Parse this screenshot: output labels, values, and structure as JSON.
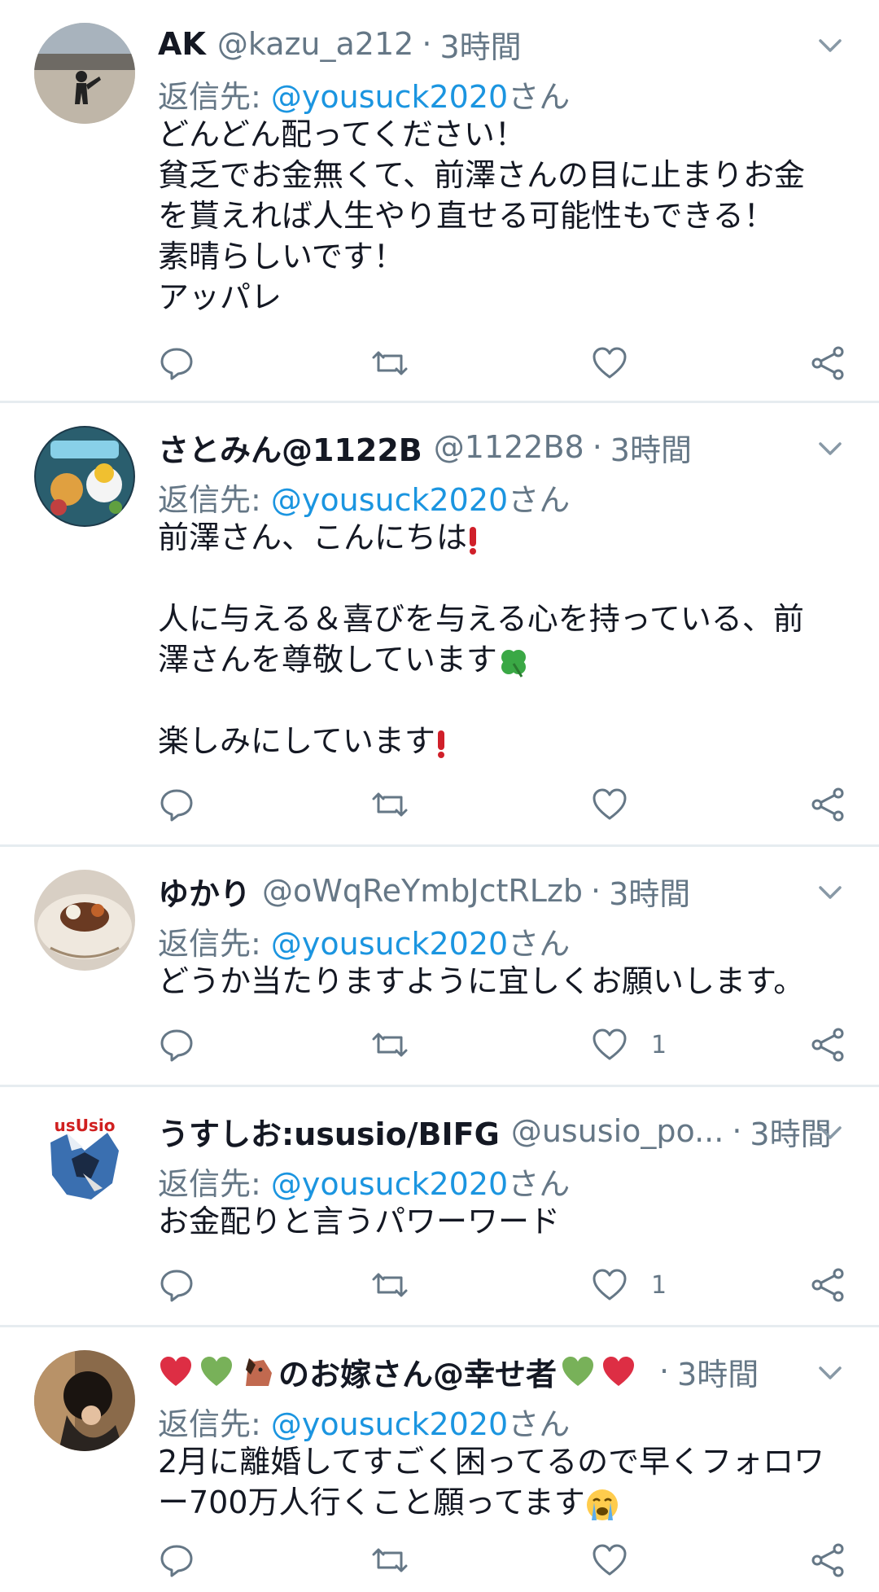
{
  "tweets": [
    {
      "name": "AK",
      "handle": "@kazu_a212",
      "separator": "·",
      "time": "3時間",
      "reply_prefix": "返信先: ",
      "reply_mention": "@yousuck2020",
      "reply_suffix": "さん",
      "body": "どんどん配ってください！\n貧乏でお金無くて、前澤さんの目に止まりお金\nを貰えれば人生やり直せる可能性もできる！\n素晴らしいです！\nアッパレ",
      "like_count": ""
    },
    {
      "name": "さとみん@1122B",
      "handle": "@1122B8",
      "separator": "·",
      "time": "3時間",
      "reply_prefix": "返信先: ",
      "reply_mention": "@yousuck2020",
      "reply_suffix": "さん",
      "body_line1": "前澤さん、こんにちは",
      "body_line2": "人に与える＆喜びを与える心を持っている、前\n澤さんを尊敬しています",
      "body_line3": "楽しみにしています",
      "like_count": ""
    },
    {
      "name": "ゆかり",
      "handle": "@oWqReYmbJctRLzb",
      "separator": "·",
      "time": "3時間",
      "reply_prefix": "返信先: ",
      "reply_mention": "@yousuck2020",
      "reply_suffix": "さん",
      "body": "どうか当たりますように宜しくお願いします。",
      "like_count": "1"
    },
    {
      "name": "うすしお:ususio/BIFG",
      "handle": "@ususio_po...",
      "separator": "·",
      "time": "3時間",
      "reply_prefix": "返信先: ",
      "reply_mention": "@yousuck2020",
      "reply_suffix": "さん",
      "body": "お金配りと言うパワーワード",
      "like_count": "1",
      "avatar_text": "usUsio"
    },
    {
      "name": "のお嫁さん@幸せ者",
      "handle": "",
      "separator": "·",
      "time": "3時間",
      "reply_prefix": "返信先: ",
      "reply_mention": "@yousuck2020",
      "reply_suffix": "さん",
      "body": "2月に離婚してすごく困ってるので早くフォロワ\nー700万人行くこと願ってます",
      "like_count": ""
    }
  ],
  "colors": {
    "text": "#141823",
    "secondary": "#657786",
    "link": "#1b95e0",
    "divider": "#e6ecf0"
  }
}
